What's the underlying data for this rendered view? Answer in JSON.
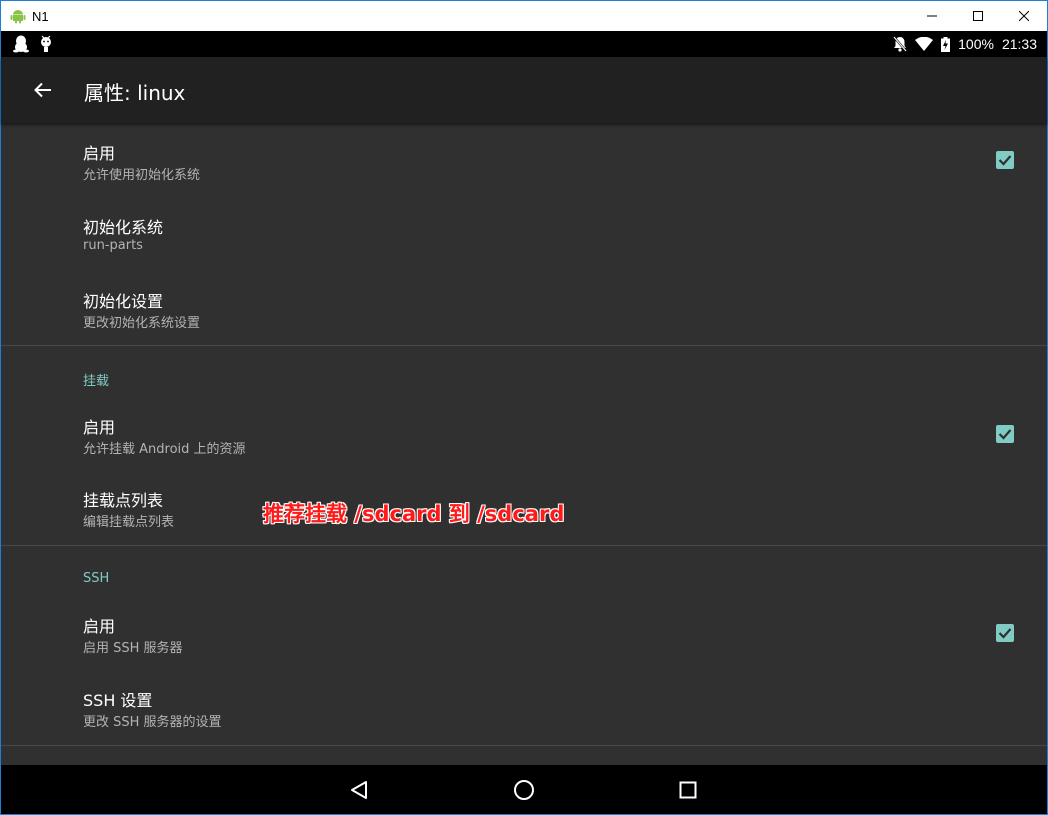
{
  "window": {
    "title": "N1",
    "icon": "android-icon",
    "controls": [
      "minimize-icon",
      "maximize-icon",
      "close-icon"
    ]
  },
  "status_bar": {
    "left_icons": [
      "qq-penguin-icon",
      "android-debug-icon"
    ],
    "right_icons": [
      "notifications-off-icon",
      "wifi-icon",
      "battery-charging-icon"
    ],
    "battery": "100%",
    "time": "21:33"
  },
  "toolbar": {
    "back_icon": "arrow-back-icon",
    "title": "属性: linux"
  },
  "sections": {
    "init": {
      "items": [
        {
          "title": "启用",
          "summary": "允许使用初始化系统",
          "checked": true
        },
        {
          "title": "初始化系统",
          "summary": "run-parts"
        },
        {
          "title": "初始化设置",
          "summary": "更改初始化系统设置"
        }
      ]
    },
    "mount": {
      "header": "挂载",
      "items": [
        {
          "title": "启用",
          "summary": "允许挂载 Android 上的资源",
          "checked": true
        },
        {
          "title": "挂载点列表",
          "summary": "编辑挂载点列表"
        }
      ]
    },
    "ssh": {
      "header": "SSH",
      "items": [
        {
          "title": "启用",
          "summary": "启用 SSH 服务器",
          "checked": true
        },
        {
          "title": "SSH 设置",
          "summary": "更改 SSH 服务器的设置"
        }
      ]
    }
  },
  "annotation": "推荐挂载 /sdcard 到 /sdcard",
  "nav_bar": {
    "icons": [
      "nav-back-icon",
      "nav-home-icon",
      "nav-recents-icon"
    ]
  },
  "colors": {
    "accent": "#80cbc4",
    "background": "#303030",
    "toolbar": "#212121",
    "annotation": "#ff1a1a",
    "window_border": "#1a7fd6"
  }
}
